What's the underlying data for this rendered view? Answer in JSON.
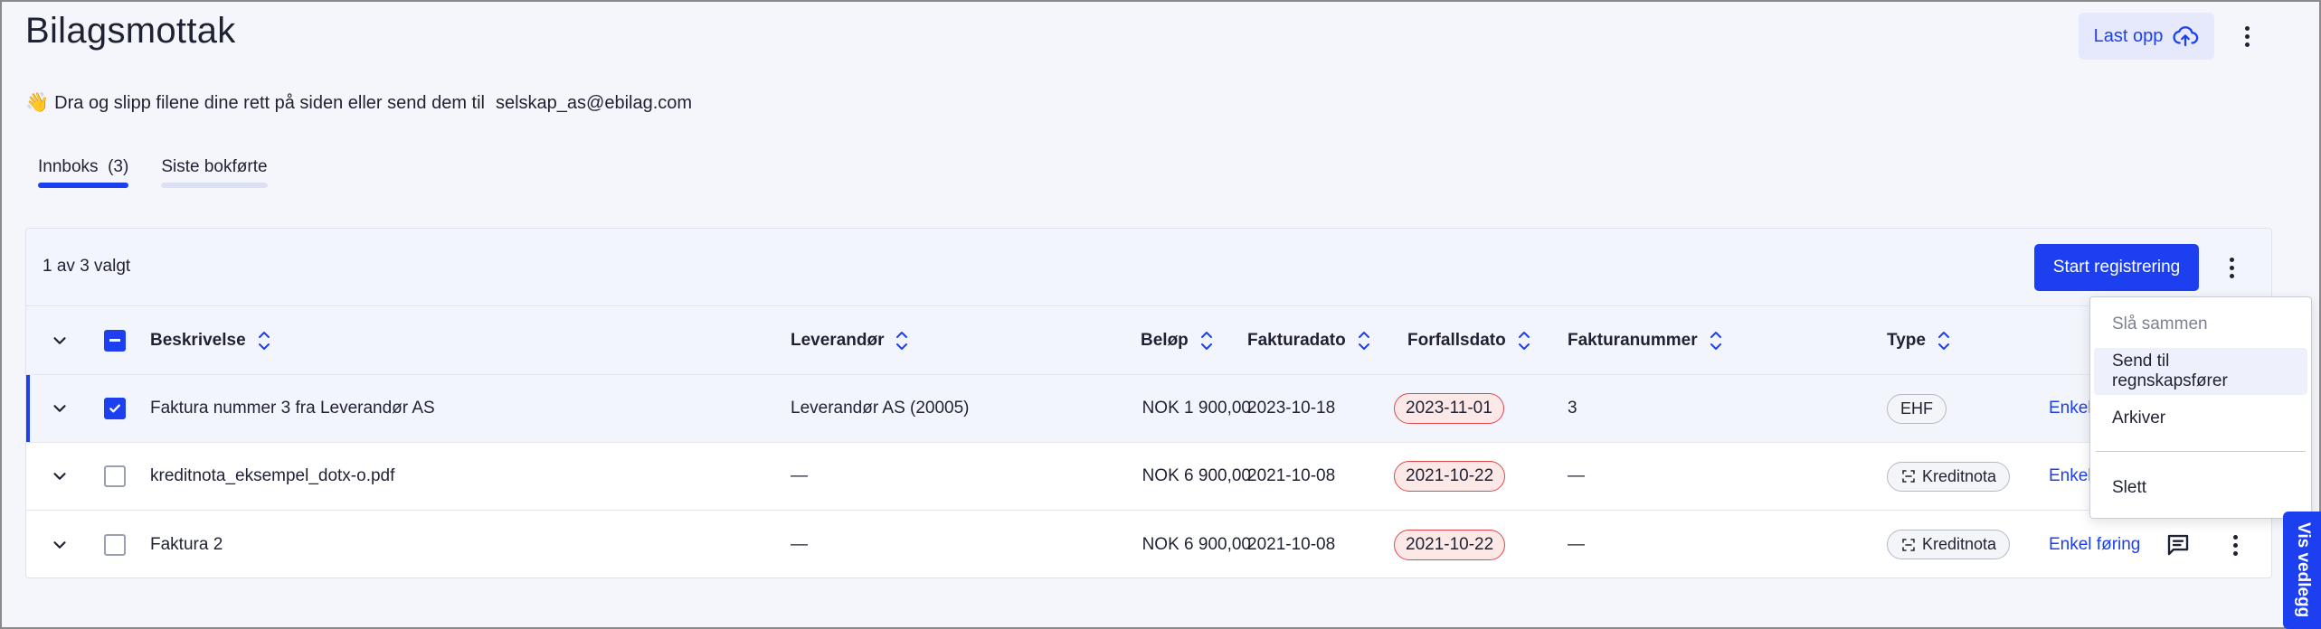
{
  "header": {
    "title": "Bilagsmottak",
    "upload_label": "Last opp",
    "upload_icon": "cloud-upload-icon"
  },
  "hint": {
    "emoji": "👋",
    "text": "Dra og slipp filene dine rett på siden eller send dem til",
    "email": "selskap_as@ebilag.com"
  },
  "tabs": [
    {
      "label": "Innboks  (3)",
      "active": true
    },
    {
      "label": "Siste bokførte",
      "active": false
    }
  ],
  "toolbar": {
    "selected_text": "1 av 3 valgt",
    "start_label": "Start registrering"
  },
  "table": {
    "columns": {
      "description": "Beskrivelse",
      "supplier": "Leverandør",
      "amount": "Beløp",
      "invoice_date": "Fakturadato",
      "due_date": "Forfallsdato",
      "invoice_number": "Fakturanummer",
      "type": "Type"
    },
    "rows": [
      {
        "checked": true,
        "description": "Faktura nummer 3 fra Leverandør AS",
        "supplier": "Leverandør AS (20005)",
        "amount": "NOK 1 900,00",
        "invoice_date": "2023-10-18",
        "due_date": "2023-11-01",
        "invoice_number": "3",
        "type": "EHF",
        "action": "Enkel"
      },
      {
        "checked": false,
        "description": "kreditnota_eksempel_dotx-o.pdf",
        "supplier": "—",
        "amount": "NOK 6 900,00",
        "invoice_date": "2021-10-08",
        "due_date": "2021-10-22",
        "invoice_number": "—",
        "type": "Kreditnota",
        "action": "Enkel"
      },
      {
        "checked": false,
        "description": "Faktura 2",
        "supplier": "—",
        "amount": "NOK 6 900,00",
        "invoice_date": "2021-10-08",
        "due_date": "2021-10-22",
        "invoice_number": "—",
        "type": "Kreditnota",
        "action": "Enkel føring"
      }
    ]
  },
  "menu": {
    "items": [
      "Slå sammen",
      "Send til regnskapsfører",
      "Arkiver",
      "Slett"
    ]
  },
  "side_tab": {
    "label": "Vis vedlegg"
  },
  "colors": {
    "accent": "#1c3ff0",
    "danger": "#e0464b"
  }
}
